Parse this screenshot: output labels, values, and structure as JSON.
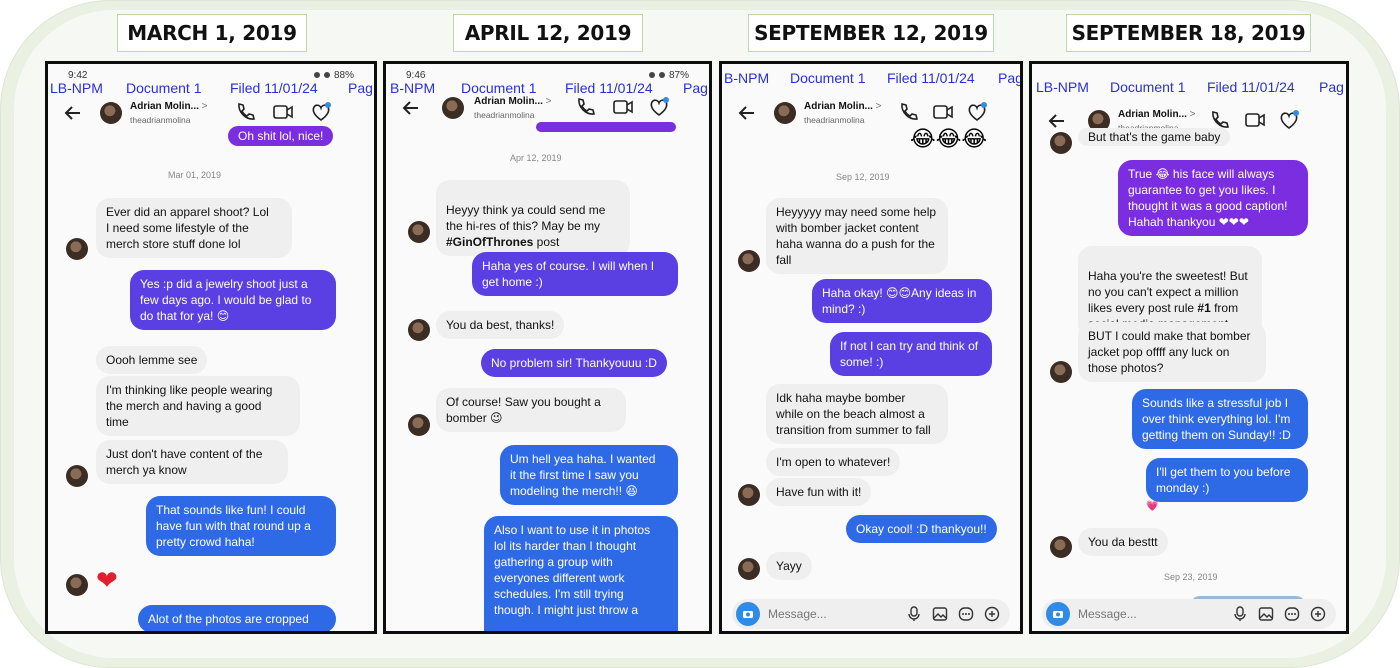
{
  "date_labels": [
    "MARCH 1, 2019",
    "APRIL 12, 2019",
    "SEPTEMBER 12, 2019",
    "SEPTEMBER 18, 2019"
  ],
  "stamp": {
    "lbnpm": "LB-NPM",
    "bnpm": "B-NPM",
    "document": "Document 1",
    "filed": "Filed 11/01/24",
    "page": "Pag"
  },
  "contact": {
    "name": "Adrian Molin...",
    "chevron": ">",
    "handle": "theadrianmolina"
  },
  "status": {
    "p1_time": "9:42",
    "p1_batt": "88%",
    "p2_time": "9:46",
    "p2_batt": "87%"
  },
  "p1": {
    "top_bubble": "Oh shit lol, nice!",
    "date": "Mar 01, 2019",
    "m1": "Ever did an apparel shoot? Lol\nI need some lifestyle of the\nmerch store stuff done lol",
    "m2": "Yes :p did a jewelry shoot just a\nfew days ago. I would be glad to\ndo that for ya! 😊",
    "m3": "Oooh lemme see",
    "m4": "I'm thinking like people wearing\nthe merch and having a good\ntime",
    "m5": "Just don't have content of the\nmerch ya know",
    "m6": "That sounds like fun! I could\nhave fun with that round up a\npretty crowd haha!",
    "heart": "❤",
    "m7": "Alot of the photos are cropped"
  },
  "p2": {
    "date": "Apr 12, 2019",
    "m1": "Heyyy think ya could send me\nthe hi-res of this? May be my",
    "m1_tag": "#GinOfThrones",
    "m1_tail": " post",
    "m2": "Haha yes of course. I will when I\nget home :)",
    "m3": "You da best, thanks!",
    "m4": "No problem sir! Thankyouuu :D",
    "m5": "Of course! Saw you bought a\nbomber 😉",
    "m6": "Um hell yea haha. I wanted\nit the first time I saw you\nmodeling the merch!! 😆",
    "m7": "Also I want to use it in photos\nlol its harder than I thought\ngathering a group with\neveryones different work\nschedules. I'm still trying\nthough. I might just throw a"
  },
  "p3": {
    "laughs": "😂😂😂",
    "date": "Sep 12, 2019",
    "m1": "Heyyyyy may need some help\nwith bomber jacket content\nhaha wanna do a push for the\nfall",
    "m2": "Haha okay! 😊😊Any ideas in\nmind? :)",
    "m3": "If not I can try and think of\nsome! :)",
    "m4": "Idk haha maybe bomber\nwhile on the beach almost a\ntransition from summer to fall",
    "m5": "I'm open to whatever!",
    "m6": "Have fun with it!",
    "m7": "Okay cool! :D thankyou!!",
    "m8": "Yayy",
    "composer": "Message..."
  },
  "p4": {
    "top_bubble": "But that's the game baby",
    "m1": "True 😂 his face will always\nguarantee to get you likes. I\nthought it was a good caption!\nHahah thankyou ❤❤❤",
    "m2_a": "Haha you're the sweetest! But\nno you can't expect a million\nlikes every post rule ",
    "m2_bold": "#1",
    "m2_b": " from\nsocial media management",
    "m3": "BUT I could make that bomber\njacket pop offff any luck on\nthose photos?",
    "m4": "Sounds like a stressful job I\nover think everything lol. I'm\ngetting them on Sunday!! :D",
    "m5": "I'll get them to you before\nmonday :)",
    "reaction": "💗",
    "m6": "You da besttt",
    "date": "Sep 23, 2019",
    "composer": "Message..."
  },
  "colors": {
    "purple": "#7a2ee0",
    "blue": "#2f6ae6",
    "received": "#efefef",
    "stamp_blue": "#2830d8"
  }
}
